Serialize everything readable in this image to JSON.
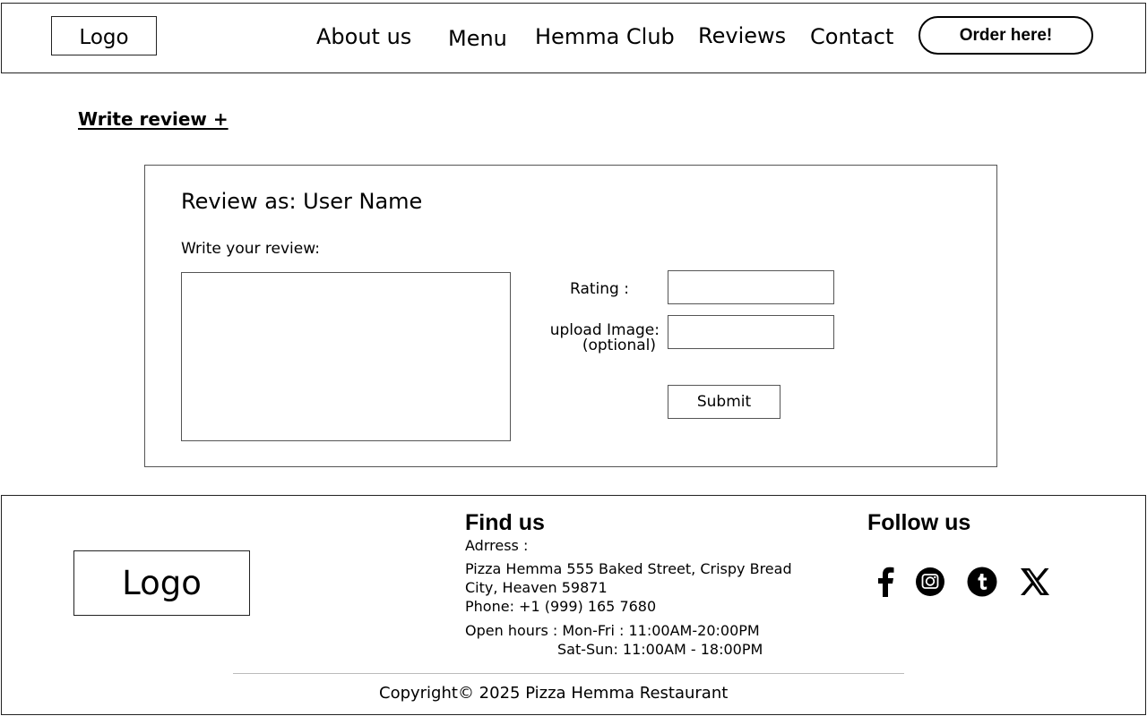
{
  "header": {
    "logo": "Logo",
    "nav": [
      "About us",
      "Menu",
      "Hemma Club",
      "Reviews",
      "Contact"
    ],
    "order_button": "Order here!"
  },
  "write_review_link": "Write review +",
  "review_form": {
    "title": "Review as: User Name",
    "write_label": "Write your review:",
    "review_value": "",
    "rating_label": "Rating :",
    "rating_value": "",
    "upload_label_line1": "upload Image:",
    "upload_label_line2": "(optional)",
    "submit_label": "Submit"
  },
  "footer": {
    "logo": "Logo",
    "find_us": {
      "title": "Find us",
      "address_label": "Adrress :",
      "address_line1": "Pizza Hemma 555 Baked Street, Crispy Bread",
      "address_line2": "City, Heaven 59871",
      "phone": "Phone: +1 (999) 165 7680",
      "hours_weekdays": "Open hours : Mon-Fri : 11:00AM-20:00PM",
      "hours_weekend": "Sat-Sun: 11:00AM - 18:00PM"
    },
    "follow_us": {
      "title": "Follow us",
      "icons": [
        "facebook-icon",
        "instagram-icon",
        "tumblr-icon",
        "x-icon"
      ]
    },
    "copyright": "Copyright©  2025 Pizza Hemma Restaurant"
  }
}
